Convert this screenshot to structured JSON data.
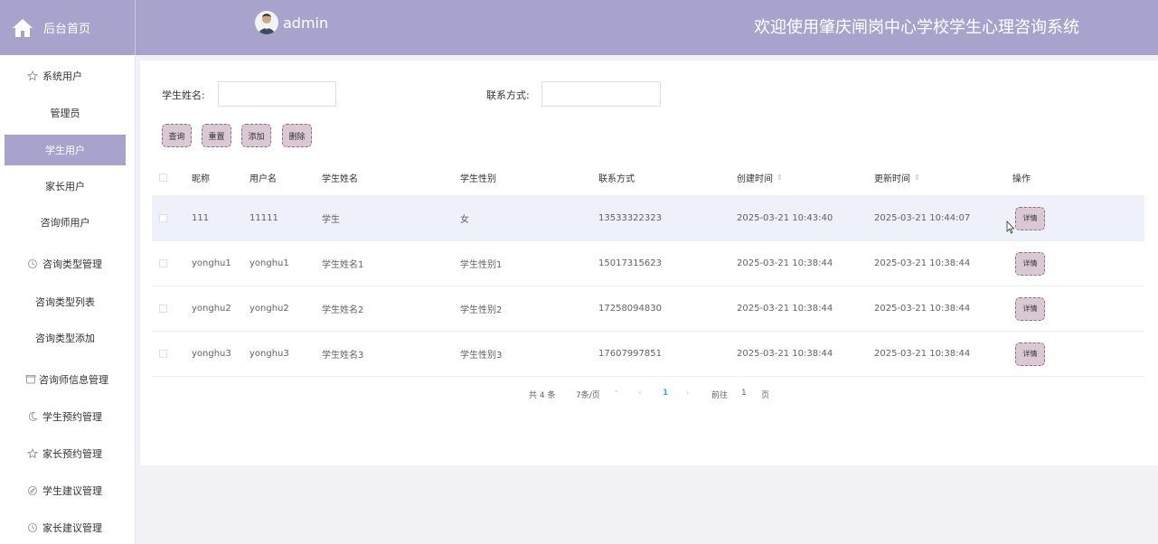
{
  "header": {
    "home_label": "后台首页",
    "username": "admin",
    "welcome": "欢迎使用肇庆闸岗中心学校学生心理咨询系统"
  },
  "sidebar": {
    "groups": [
      {
        "label": "系统用户",
        "icon": "star-icon"
      },
      {
        "label": "咨询类型管理",
        "icon": "clock-icon"
      },
      {
        "label": "咨询师信息管理",
        "icon": "box-icon"
      },
      {
        "label": "学生预约管理",
        "icon": "moon-icon"
      },
      {
        "label": "家长预约管理",
        "icon": "star-icon"
      },
      {
        "label": "学生建议管理",
        "icon": "compass-icon"
      },
      {
        "label": "家长建议管理",
        "icon": "clock-icon"
      }
    ],
    "items": {
      "admin": "管理员",
      "student": "学生用户",
      "parent": "家长用户",
      "counselor": "咨询师用户",
      "type_list": "咨询类型列表",
      "type_add": "咨询类型添加"
    }
  },
  "search": {
    "name_label": "学生姓名:",
    "name_value": "",
    "contact_label": "联系方式:",
    "contact_value": ""
  },
  "actions": {
    "query": "查询",
    "reset": "重置",
    "add": "添加",
    "delete": "删除"
  },
  "table": {
    "headers": {
      "nickname": "昵称",
      "username": "用户名",
      "student_name": "学生姓名",
      "gender": "学生性别",
      "contact": "联系方式",
      "created": "创建时间",
      "updated": "更新时间",
      "ops": "操作"
    },
    "sort_icon": "⇕",
    "detail_label": "详情",
    "rows": [
      {
        "nickname": "111",
        "username": "11111",
        "student_name": "学生",
        "gender": "女",
        "contact": "13533322323",
        "created": "2025-03-21 10:43:40",
        "updated": "2025-03-21 10:44:07"
      },
      {
        "nickname": "yonghu1",
        "username": "yonghu1",
        "student_name": "学生姓名1",
        "gender": "学生性别1",
        "contact": "15017315623",
        "created": "2025-03-21 10:38:44",
        "updated": "2025-03-21 10:38:44"
      },
      {
        "nickname": "yonghu2",
        "username": "yonghu2",
        "student_name": "学生姓名2",
        "gender": "学生性别2",
        "contact": "17258094830",
        "created": "2025-03-21 10:38:44",
        "updated": "2025-03-21 10:38:44"
      },
      {
        "nickname": "yonghu3",
        "username": "yonghu3",
        "student_name": "学生姓名3",
        "gender": "学生性别3",
        "contact": "17607997851",
        "created": "2025-03-21 10:38:44",
        "updated": "2025-03-21 10:38:44"
      }
    ]
  },
  "pagination": {
    "total": "共 4 条",
    "page_size": "7条/页",
    "size_arrow": "⌄",
    "prev": "‹",
    "current": "1",
    "next": "›",
    "goto_label": "前往",
    "goto_value": "1",
    "page_suffix": "页"
  },
  "colors": {
    "accent": "#a8a3cd",
    "button_bg": "#dac9d5",
    "row_highlight": "#eef0fa"
  }
}
